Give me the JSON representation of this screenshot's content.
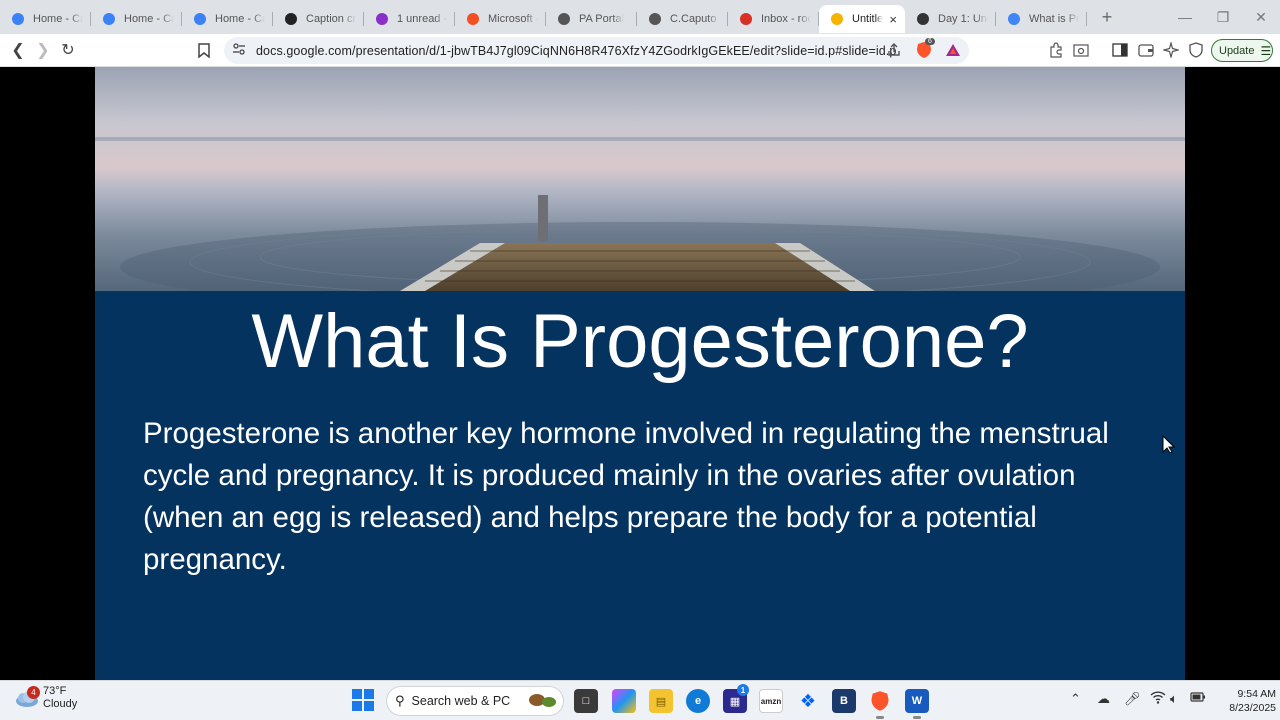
{
  "browser": {
    "tabs": [
      {
        "label": "Home - Ca",
        "icon": "canva-icon",
        "color": "#3b82f6"
      },
      {
        "label": "Home - Ca",
        "icon": "canva-icon",
        "color": "#3b82f6"
      },
      {
        "label": "Home - Ca",
        "icon": "canva-icon",
        "color": "#3b82f6"
      },
      {
        "label": "Caption cr",
        "icon": "chatgpt-icon",
        "color": "#222222"
      },
      {
        "label": "1 unread -",
        "icon": "mail-icon",
        "color": "#8b2fc9"
      },
      {
        "label": "Microsoft -",
        "icon": "microsoft-icon",
        "color": "#f25022"
      },
      {
        "label": "PA Portal",
        "icon": "portal-icon",
        "color": "#555555"
      },
      {
        "label": "C.Caputo D",
        "icon": "globe-icon",
        "color": "#555555"
      },
      {
        "label": "Inbox - roc",
        "icon": "gmail-icon",
        "color": "#d93025"
      },
      {
        "label": "Untitle",
        "icon": "slides-icon",
        "color": "#f4b400",
        "active": true
      },
      {
        "label": "Day 1: Und",
        "icon": "cube-icon",
        "color": "#333333"
      },
      {
        "label": "What is Pro",
        "icon": "docs-icon",
        "color": "#4285f4"
      }
    ],
    "new_tab_label": "+",
    "close_tab_glyph": "×",
    "url": "docs.google.com/presentation/d/1-jbwTB4J7gl09CiqNN6H8R476XfzY4ZGodrkIgGEkEE/edit?slide=id.p#slide=id.p",
    "shield_count": "6",
    "update_label": "Update"
  },
  "slide": {
    "title": "What Is Progesterone?",
    "body": "Progesterone is another key hormone involved in regulating the menstrual cycle and pregnancy. It is produced mainly in the ovaries after ovulation (when an egg is released) and helps prepare the body for a potential pregnancy.",
    "background_color": "#05335f"
  },
  "taskbar": {
    "weather_badge": "4",
    "temperature": "73°F",
    "condition": "Cloudy",
    "search_placeholder": "Search web & PC",
    "store_badge": "1",
    "time": "9:54 AM",
    "date": "8/23/2025"
  }
}
